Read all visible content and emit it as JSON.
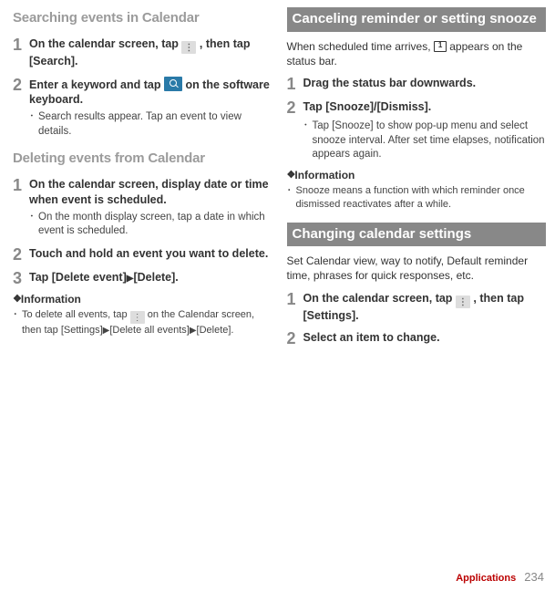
{
  "left": {
    "h1": "Searching events in Calendar",
    "s1": {
      "num": "1",
      "title_a": "On the calendar screen, tap ",
      "title_b": " , then tap [Search]."
    },
    "s2": {
      "num": "2",
      "title_a": "Enter a keyword and tap ",
      "title_b": " on the software keyboard.",
      "bullet": "Search results appear. Tap an event to view details."
    },
    "h2": "Deleting events from Calendar",
    "s3": {
      "num": "1",
      "title": "On the calendar screen, display date or time when event is scheduled.",
      "bullet": "On the month display screen, tap a date in which event is scheduled."
    },
    "s4": {
      "num": "2",
      "title": "Touch and hold an event you want to delete."
    },
    "s5": {
      "num": "3",
      "title_a": "Tap [Delete event]",
      "title_b": "[Delete]."
    },
    "info_label": "Information",
    "info_a": "To delete all events, tap ",
    "info_b": " on the Calendar screen, then tap [Settings]",
    "info_c": "[Delete all events]",
    "info_d": "[Delete]."
  },
  "right": {
    "h1": "Canceling reminder or setting snooze",
    "p1_a": "When scheduled time arrives, ",
    "p1_b": " appears on the status bar.",
    "s1": {
      "num": "1",
      "title": "Drag the status bar downwards."
    },
    "s2": {
      "num": "2",
      "title": "Tap [Snooze]/[Dismiss].",
      "bullet": "Tap [Snooze] to show pop-up menu and select snooze interval. After set time elapses, notification appears again."
    },
    "info_label": "Information",
    "info_bullet": "Snooze means a function with which reminder once dismissed reactivates after a while.",
    "h2": "Changing calendar settings",
    "p2": "Set Calendar view, way to notify, Default reminder time, phrases for quick responses, etc.",
    "s3": {
      "num": "1",
      "title_a": "On the calendar screen, tap ",
      "title_b": " , then tap [Settings]."
    },
    "s4": {
      "num": "2",
      "title": "Select an item to change."
    }
  },
  "footer": {
    "label": "Applications",
    "page": "234"
  },
  "glyph": {
    "dot": "･",
    "arrow": "▶"
  }
}
